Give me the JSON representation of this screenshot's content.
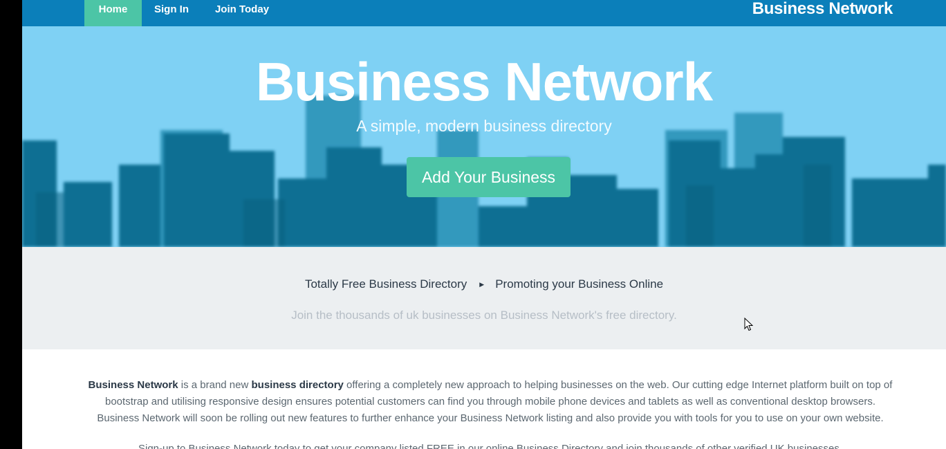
{
  "nav": {
    "items": [
      {
        "label": "Home",
        "active": true
      },
      {
        "label": "Sign In",
        "active": false
      },
      {
        "label": "Join Today",
        "active": false
      }
    ],
    "brand": "Business Network"
  },
  "hero": {
    "title": "Business Network",
    "subtitle": "A simple, modern business directory",
    "cta": "Add Your Business"
  },
  "band": {
    "tag1": "Totally Free Business Directory",
    "separator": "▶",
    "tag2": "Promoting your Business Online",
    "subtext": "Join the thousands of uk businesses on Business Network's free directory."
  },
  "content": {
    "p1_brand": "Business Network",
    "p1_a": " is a brand new ",
    "p1_bold": "business directory",
    "p1_b": " offering a completely new approach to helping businesses on the web. Our cutting edge Internet platform built on top of bootstrap and utilising responsive design ensures potential customers can find you through mobile phone devices and tablets as well as conventional desktop browsers. Business Network will soon be rolling out new features to further enhance your Business Network listing and also provide you with tools for you to use on your own website.",
    "p2": "Sign-up to Business Network today to get your company listed FREE in our online Business Directory and join thousands of other verified UK businesses."
  },
  "colors": {
    "navbar": "#0b7fba",
    "accent": "#4cc5a6",
    "hero_sky": "#7fd1f4",
    "band": "#eceff1"
  }
}
